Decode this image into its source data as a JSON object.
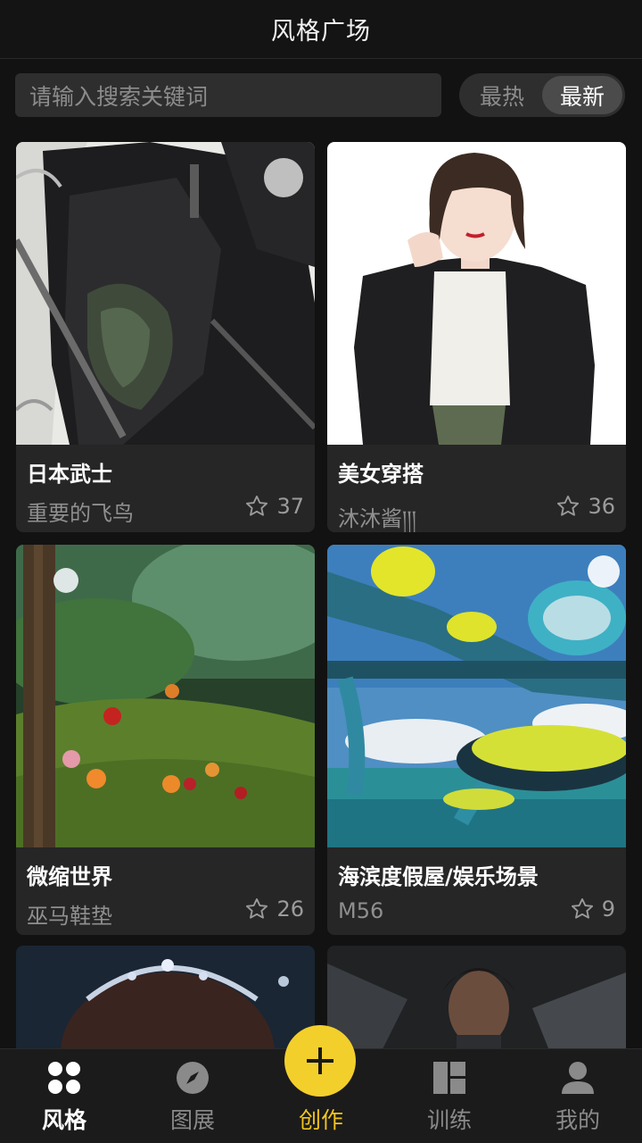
{
  "header": {
    "title": "风格广场"
  },
  "search": {
    "placeholder": "请输入搜索关键词"
  },
  "sort": {
    "options": [
      "最热",
      "最新"
    ],
    "active": "最新"
  },
  "cards": [
    {
      "title": "日本武士",
      "author": "重要的飞鸟",
      "likes": "37"
    },
    {
      "title": "美女穿搭",
      "author": "沐沐酱།།།",
      "likes": "36"
    },
    {
      "title": "微缩世界",
      "author": "巫马鞋垫",
      "likes": "26"
    },
    {
      "title": "海滨度假屋/娱乐场景",
      "author": "M56",
      "likes": "9"
    }
  ],
  "tabs": [
    {
      "label": "风格",
      "icon": "grid-icon",
      "active": true
    },
    {
      "label": "图展",
      "icon": "compass-icon"
    },
    {
      "label": "创作",
      "icon": "plus-icon"
    },
    {
      "label": "训练",
      "icon": "dashboard-icon"
    },
    {
      "label": "我的",
      "icon": "user-icon"
    }
  ],
  "colors": {
    "accent": "#f3cf2c",
    "background": "#121212",
    "card": "#262626"
  }
}
